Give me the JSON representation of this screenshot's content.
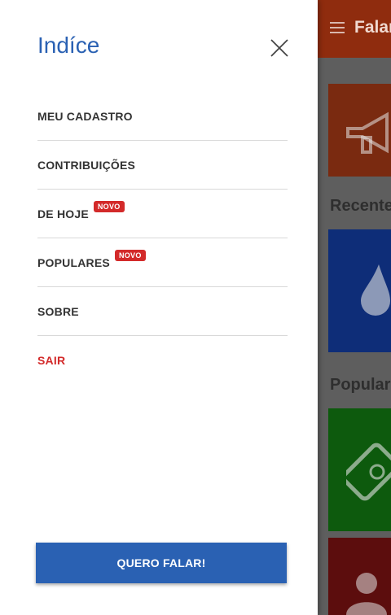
{
  "drawer": {
    "title": "Indíce",
    "menu": [
      {
        "label": "MEU CADASTRO",
        "badge": null
      },
      {
        "label": "CONTRIBUIÇÕES",
        "badge": null
      },
      {
        "label": "DE HOJE",
        "badge": "NOVO"
      },
      {
        "label": "POPULARES",
        "badge": "NOVO"
      },
      {
        "label": "SOBRE",
        "badge": null
      },
      {
        "label": "SAIR",
        "badge": null
      }
    ],
    "cta_label": "QUERO FALAR!"
  },
  "background": {
    "app_title": "Falar",
    "sections": [
      "Recentes",
      "Populares"
    ]
  },
  "colors": {
    "accent": "#2a61b3",
    "danger": "#d32a2a",
    "header": "#8f2c0e"
  },
  "icons": [
    "close-icon",
    "hamburger-icon",
    "megaphone-icon",
    "drop-icon",
    "bandage-icon",
    "person-icon"
  ]
}
